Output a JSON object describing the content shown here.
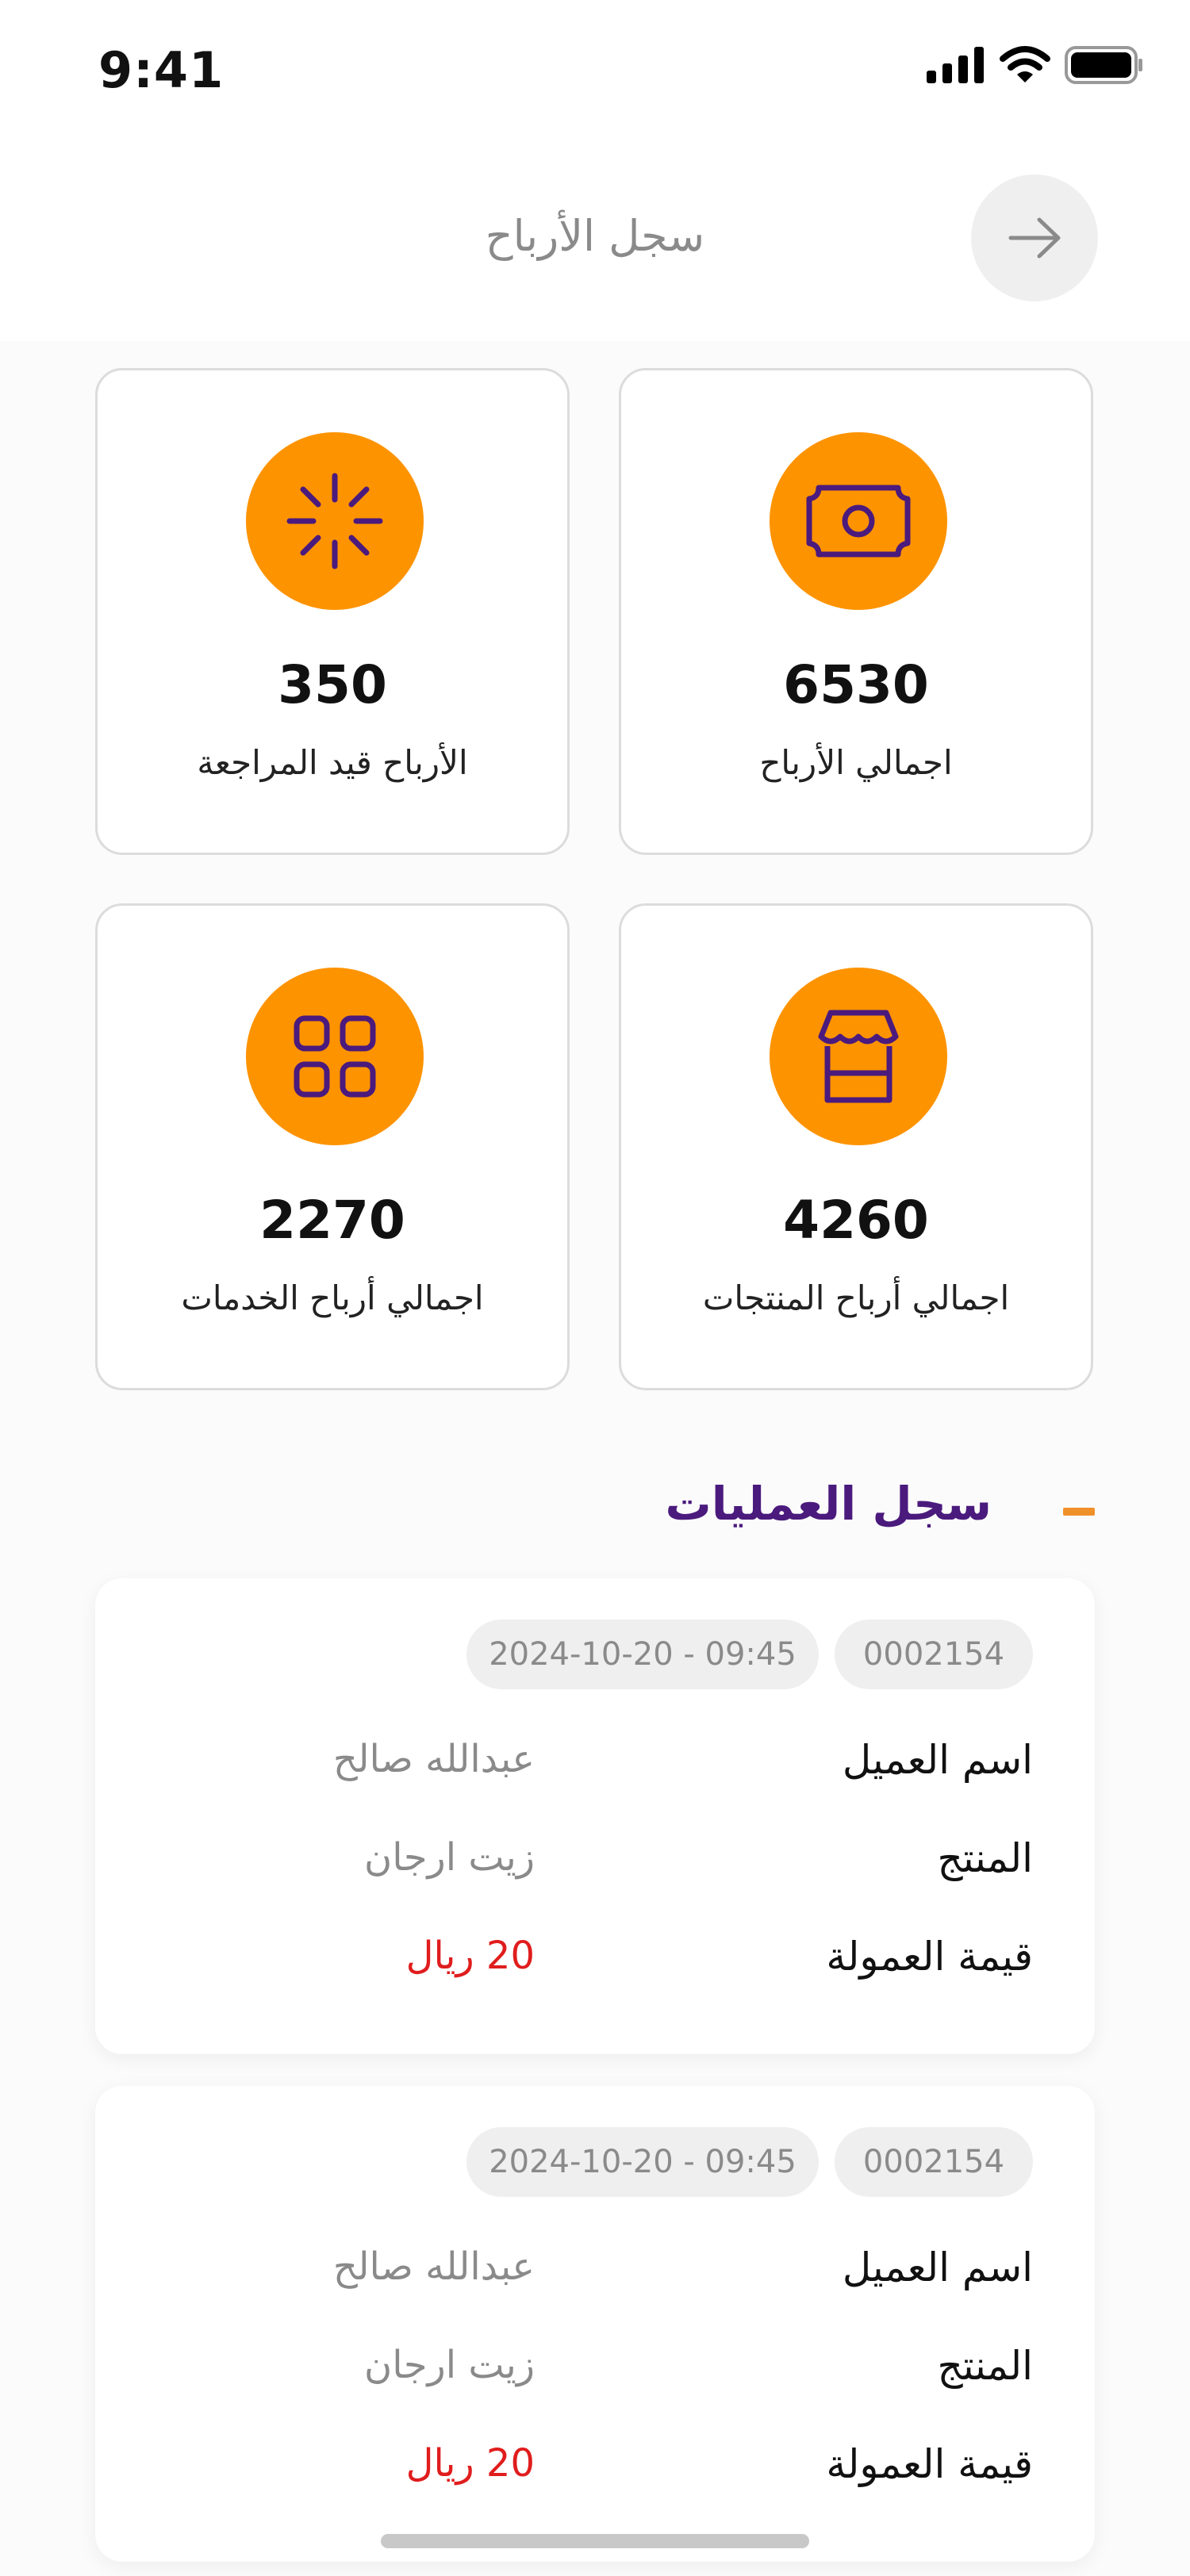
{
  "status_bar": {
    "time": "9:41"
  },
  "header": {
    "title": "سجل الأرباح",
    "back_icon": "arrow-right-icon"
  },
  "stats": [
    {
      "value": "6530",
      "label": "اجمالي الأرباح",
      "icon": "money-bill-icon"
    },
    {
      "value": "350",
      "label": "الأرباح قيد المراجعة",
      "icon": "loading-spinner-icon"
    },
    {
      "value": "4260",
      "label": "اجمالي أرباح المنتجات",
      "icon": "store-icon"
    },
    {
      "value": "2270",
      "label": "اجمالي أرباح الخدمات",
      "icon": "grid-icon"
    }
  ],
  "section": {
    "title": "سجل العمليات"
  },
  "operations": [
    {
      "id": "0002154",
      "datetime": "2024-10-20 - 09:45",
      "customer_label": "اسم العميل",
      "customer_value": "عبدالله صالح",
      "product_label": "المنتج",
      "product_value": "زيت ارجان",
      "commission_label": "قيمة العمولة",
      "commission_value": "20 ريال"
    },
    {
      "id": "0002154",
      "datetime": "2024-10-20 - 09:45",
      "customer_label": "اسم العميل",
      "customer_value": "عبدالله صالح",
      "product_label": "المنتج",
      "product_value": "زيت ارجان",
      "commission_label": "قيمة العمولة",
      "commission_value": "20 ريال"
    }
  ],
  "colors": {
    "accent": "#fe9300",
    "primary": "#4b1a7d",
    "icon_stroke": "#4b1a7d",
    "commission": "#e01d1d"
  }
}
